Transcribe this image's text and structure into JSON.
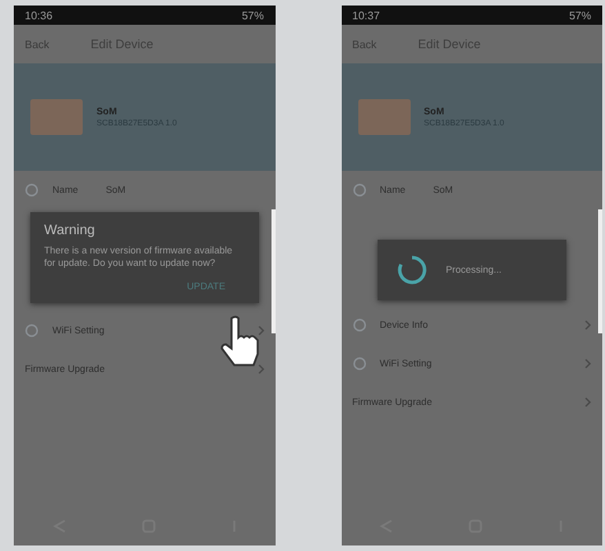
{
  "phones": [
    {
      "status_bar": {
        "time": "10:36",
        "battery": "57%"
      },
      "header": {
        "back": "Back",
        "title": "Edit Device"
      },
      "device": {
        "name": "SoM",
        "id": "SCB18B27E5D3A 1.0"
      },
      "name_row": {
        "label": "Name",
        "value": "SoM"
      },
      "dialog": {
        "kind": "warning",
        "title": "Warning",
        "message": "There is a new version of firmware available for update. Do you want to update now?",
        "button": "UPDATE"
      },
      "rows": [
        {
          "label": "WiFi Setting",
          "icon": true
        },
        {
          "label": "Firmware Upgrade",
          "icon": false
        }
      ],
      "cursor": true
    },
    {
      "status_bar": {
        "time": "10:37",
        "battery": "57%"
      },
      "header": {
        "back": "Back",
        "title": "Edit Device"
      },
      "device": {
        "name": "SoM",
        "id": "SCB18B27E5D3A 1.0"
      },
      "name_row": {
        "label": "Name",
        "value": "SoM"
      },
      "dialog": {
        "kind": "progress",
        "message": "Processing..."
      },
      "rows": [
        {
          "label": "Device Info",
          "icon": true
        },
        {
          "label": "WiFi Setting",
          "icon": true
        },
        {
          "label": "Firmware Upgrade",
          "icon": false
        }
      ],
      "cursor": false
    }
  ]
}
